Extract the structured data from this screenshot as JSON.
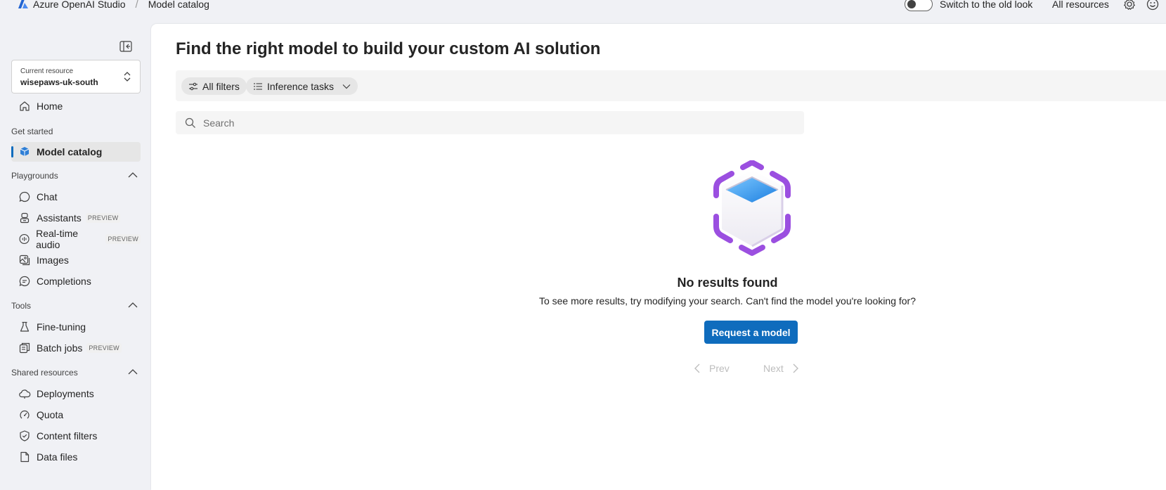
{
  "header": {
    "app_name": "Azure OpenAI Studio",
    "breadcrumb": "Model catalog",
    "toggle_label": "Switch to the old look",
    "all_resources": "All resources",
    "icons": [
      "azure-logo-icon",
      "settings-icon",
      "feedback-smiley-icon"
    ]
  },
  "sidebar": {
    "resource_label": "Current resource",
    "resource_value": "wisepaws-uk-south",
    "home": "Home",
    "get_started": {
      "title": "Get started",
      "items": [
        {
          "label": "Model catalog",
          "icon": "model-catalog-icon",
          "active": true
        }
      ]
    },
    "playgrounds": {
      "title": "Playgrounds",
      "items": [
        {
          "label": "Chat",
          "icon": "chat-icon"
        },
        {
          "label": "Assistants",
          "icon": "assistants-icon",
          "badge": "PREVIEW"
        },
        {
          "label": "Real-time audio",
          "icon": "audio-icon",
          "badge": "PREVIEW"
        },
        {
          "label": "Images",
          "icon": "images-icon"
        },
        {
          "label": "Completions",
          "icon": "completions-icon"
        }
      ]
    },
    "tools": {
      "title": "Tools",
      "items": [
        {
          "label": "Fine-tuning",
          "icon": "flask-icon"
        },
        {
          "label": "Batch jobs",
          "icon": "batch-jobs-icon",
          "badge": "PREVIEW"
        }
      ]
    },
    "shared_resources": {
      "title": "Shared resources",
      "items": [
        {
          "label": "Deployments",
          "icon": "cloud-icon"
        },
        {
          "label": "Quota",
          "icon": "quota-icon"
        },
        {
          "label": "Content filters",
          "icon": "shield-icon"
        },
        {
          "label": "Data files",
          "icon": "document-icon"
        }
      ]
    }
  },
  "main": {
    "title": "Find the right model to build your custom AI solution",
    "filters": {
      "all_filters": "All filters",
      "inference_tasks": "Inference tasks"
    },
    "search": {
      "placeholder": "Search",
      "value": ""
    },
    "empty_state": {
      "title": "No results found",
      "message": "To see more results, try modifying your search. Can't find the model you're looking for?",
      "button": "Request a model"
    },
    "pagination": {
      "prev": "Prev",
      "next": "Next"
    }
  },
  "colors": {
    "accent": "#0f6cbd",
    "background": "#f0f1f5",
    "illustration_purple": "#9b4fe0",
    "illustration_blue": "#3b9de8"
  }
}
